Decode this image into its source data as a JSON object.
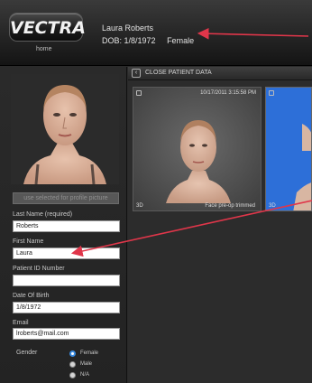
{
  "header": {
    "logo_text": "VECTRA",
    "home_label": "home",
    "patient_name": "Laura Roberts",
    "dob": "DOB: 1/8/1972",
    "gender": "Female"
  },
  "sidebar": {
    "use_profile_button": "use selected for profile picture",
    "fields": {
      "last_name": {
        "label": "Last Name (required)",
        "value": "Roberts"
      },
      "first_name": {
        "label": "First Name",
        "value": "Laura"
      },
      "patient_id": {
        "label": "Patient ID Number",
        "value": ""
      },
      "dob": {
        "label": "Date Of Birth",
        "value": "1/8/1972"
      },
      "email": {
        "label": "Email",
        "value": "lroberts@mail.com"
      }
    },
    "gender": {
      "label": "Gender",
      "options": [
        "Female",
        "Male",
        "N/A"
      ],
      "selected": "Female"
    }
  },
  "viewer": {
    "close_label": "CLOSE PATIENT DATA",
    "thumbnails": [
      {
        "timestamp": "10/17/2011 3:15:58 PM",
        "tag": "3D",
        "caption": "Face pre-op trimmed"
      },
      {
        "timestamp": "",
        "tag": "3D",
        "caption": ""
      }
    ]
  },
  "colors": {
    "annotation_arrow": "#e0364a",
    "selected_radio": "#3a8be0",
    "thumbnail_blue": "#2d6fd8"
  }
}
